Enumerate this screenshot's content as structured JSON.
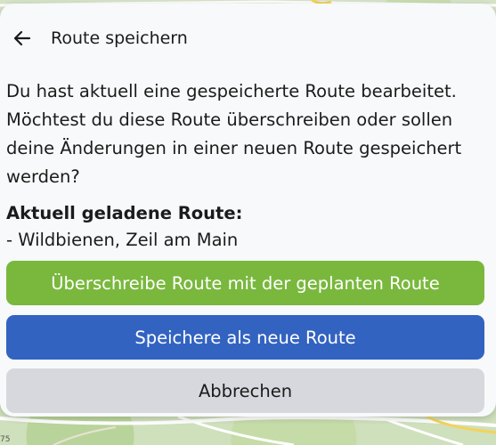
{
  "map": {
    "scale_label": "75"
  },
  "dialog": {
    "title": "Route speichern",
    "back_icon": "arrow-left-icon",
    "message": "Du hast aktuell eine gespeicherte Route bearbeitet. Möchtest du diese Route überschreiben oder sollen deine Änderungen in einer neuen Route gespeichert werden?",
    "current_route_label": "Aktuell geladene Route:",
    "current_route_name": "- Wildbienen, Zeil am Main"
  },
  "buttons": {
    "overwrite_label": "Überschreibe Route mit der geplanten Route",
    "save_new_label": "Speichere als neue Route",
    "cancel_label": "Abbrechen"
  },
  "colors": {
    "overwrite": "#79b83d",
    "save_new": "#3363c1",
    "cancel": "#d6d8dd"
  }
}
